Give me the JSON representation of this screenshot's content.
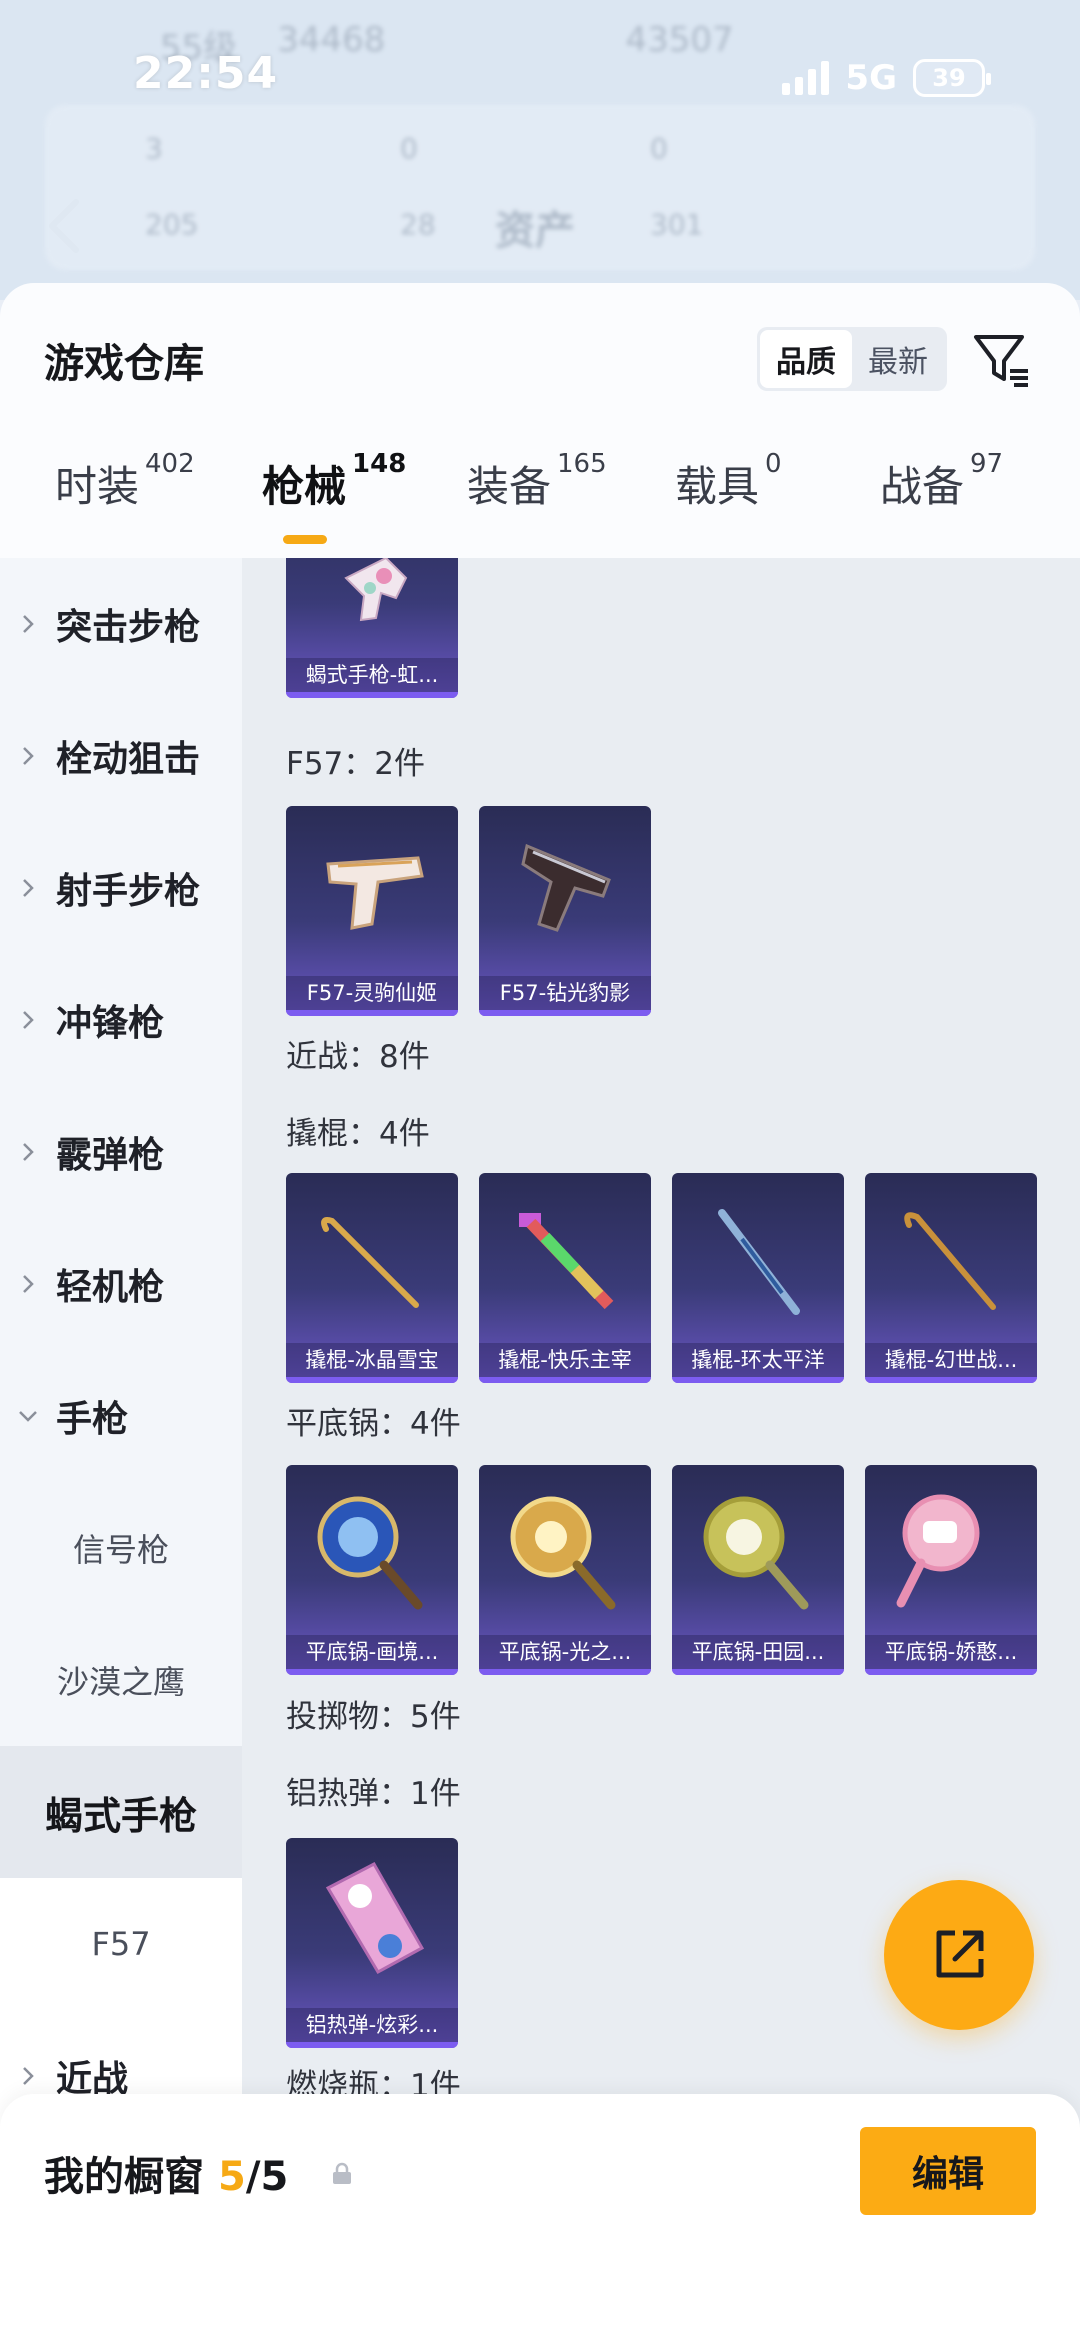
{
  "status_bar": {
    "time": "22:54",
    "network": "5G",
    "battery": "39"
  },
  "background": {
    "title": "资产",
    "row1": [
      "55级",
      "34468",
      "43507"
    ],
    "stats_top": [
      "3",
      "0",
      "0"
    ],
    "stats_bottom": [
      "205",
      "28",
      "301"
    ]
  },
  "header": {
    "title": "游戏仓库",
    "sort_options": [
      "品质",
      "最新"
    ],
    "sort_active": "品质"
  },
  "tabs": [
    {
      "label": "时装",
      "count": "402"
    },
    {
      "label": "枪械",
      "count": "148"
    },
    {
      "label": "装备",
      "count": "165"
    },
    {
      "label": "载具",
      "count": "0"
    },
    {
      "label": "战备",
      "count": "97"
    }
  ],
  "active_tab": "枪械",
  "sidebar": {
    "items": [
      {
        "label": "突击步枪"
      },
      {
        "label": "栓动狙击"
      },
      {
        "label": "射手步枪"
      },
      {
        "label": "冲锋枪"
      },
      {
        "label": "霰弹枪"
      },
      {
        "label": "轻机枪"
      },
      {
        "label": "手枪"
      }
    ],
    "sub_items": [
      "信号枪",
      "沙漠之鹰",
      "蝎式手枪",
      "F57"
    ],
    "selected": "蝎式手枪",
    "bottom_item": "近战"
  },
  "content": {
    "top_card": {
      "caption": "蝎式手枪-虹..."
    },
    "groups": [
      {
        "label": "F57：2件",
        "items": [
          "F57-灵驹仙姬",
          "F57-钻光豹影"
        ]
      },
      {
        "label": "近战：8件",
        "items": []
      },
      {
        "label": "撬棍：4件",
        "items": [
          "撬棍-冰晶雪宝",
          "撬棍-快乐主宰",
          "撬棍-环太平洋",
          "撬棍-幻世战..."
        ]
      },
      {
        "label": "平底锅：4件",
        "items": [
          "平底锅-画境...",
          "平底锅-光之...",
          "平底锅-田园...",
          "平底锅-娇憨..."
        ]
      },
      {
        "label": "投掷物：5件",
        "items": []
      },
      {
        "label": "铝热弹：1件",
        "items": [
          "铝热弹-炫彩..."
        ]
      },
      {
        "label": "燃烧瓶：1件",
        "items": []
      }
    ]
  },
  "bottom_bar": {
    "label": "我的橱窗",
    "current": "5",
    "total": "/5",
    "edit_label": "编辑"
  },
  "icons": {
    "filter": "filter-icon",
    "share": "share-external-icon",
    "lock": "lock-icon",
    "back": "back-chevron-icon"
  },
  "colors": {
    "accent": "#f6a915",
    "card_top": "#2a2c55",
    "card_bottom": "#6b57c5",
    "card_border": "#7c5cf0"
  }
}
